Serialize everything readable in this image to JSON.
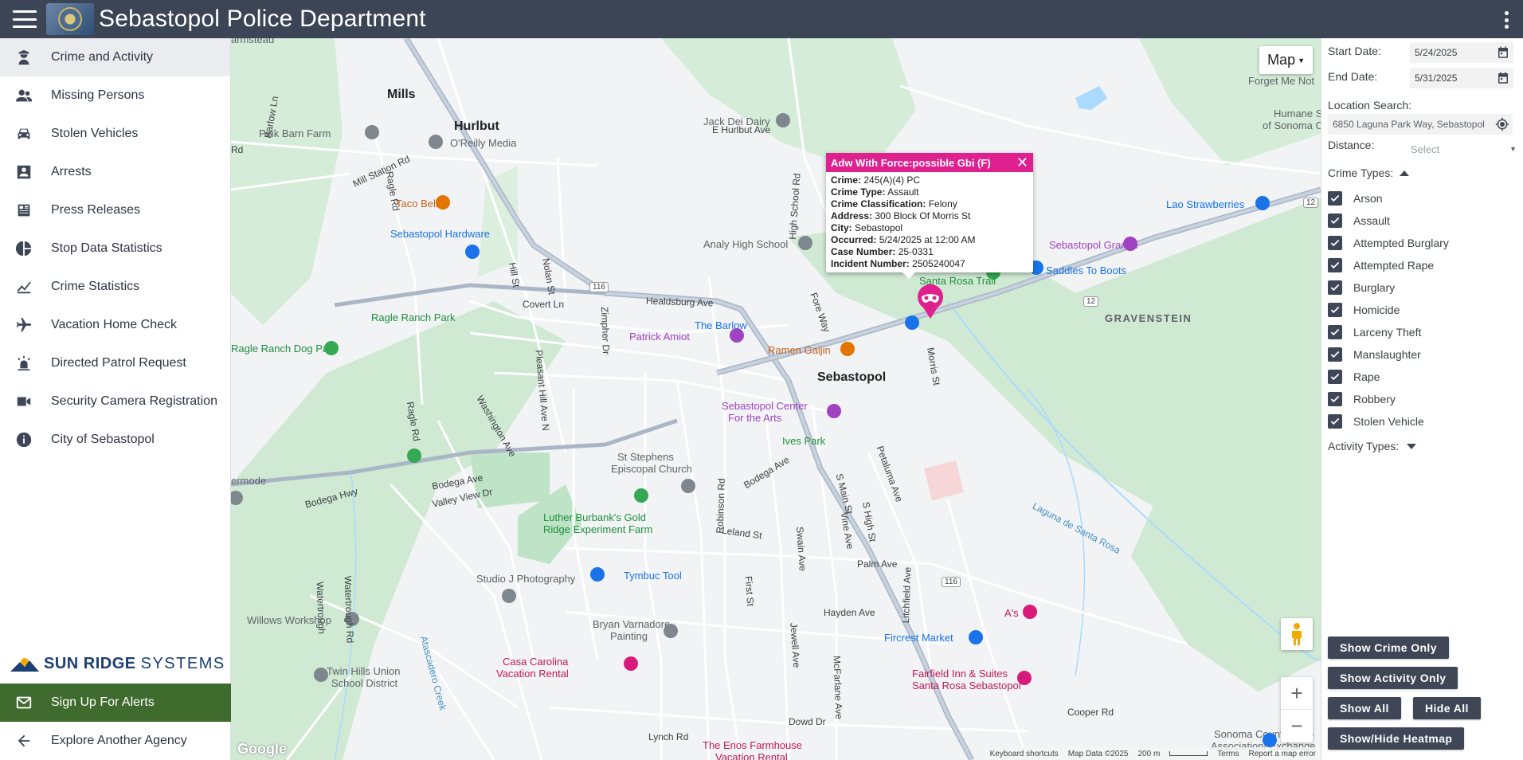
{
  "header": {
    "title": "Sebastopol Police Department"
  },
  "sidebar": {
    "items": [
      {
        "label": "Crime and Activity",
        "icon": "police-officer-icon"
      },
      {
        "label": "Missing Persons",
        "icon": "people-icon"
      },
      {
        "label": "Stolen Vehicles",
        "icon": "car-icon"
      },
      {
        "label": "Arrests",
        "icon": "id-card-icon"
      },
      {
        "label": "Press Releases",
        "icon": "newspaper-icon"
      },
      {
        "label": "Stop Data Statistics",
        "icon": "pie-chart-icon"
      },
      {
        "label": "Crime Statistics",
        "icon": "line-chart-icon"
      },
      {
        "label": "Vacation Home Check",
        "icon": "airplane-icon"
      },
      {
        "label": "Directed Patrol Request",
        "icon": "siren-icon"
      },
      {
        "label": "Security Camera Registration",
        "icon": "video-camera-icon"
      },
      {
        "label": "City of Sebastopol",
        "icon": "info-icon"
      }
    ],
    "brand": {
      "bold": "SUN RIDGE",
      "light": "SYSTEMS"
    },
    "alerts_label": "Sign Up For Alerts",
    "explore_label": "Explore Another Agency"
  },
  "map": {
    "type_label": "Map",
    "labels": {
      "mills": "Mills",
      "hurlbut": "Hurlbut",
      "sebastopol": "Sebastopol",
      "gravenstein": "GRAVENSTEIN",
      "pink_barn": "Pink Barn Farm",
      "oreilly": "O'Reilly Media",
      "taco_bell": "Taco Bell",
      "hardware": "Sebastopol Hardware",
      "analy": "Analy High School",
      "jack_dei": "Jack Dei Dairy",
      "ragle_ranch": "Ragle Ranch Park",
      "ragle_dog": "Ragle Ranch Dog Park",
      "patrick": "Patrick Amiot",
      "barlow": "The Barlow",
      "ramen": "Ramen Gaijin",
      "center1": "Sebastopol Center",
      "center2": "For the Arts",
      "ives": "Ives Park",
      "st_stephens1": "St Stephens",
      "st_stephens2": "Episcopal Church",
      "luther1": "Luther Burbank's Gold",
      "luther2": "Ridge Experiment Farm",
      "tymbuc": "Tymbuc Tool",
      "studio_j": "Studio J Photography",
      "willows": "Willows Workshop",
      "twin_hills1": "Twin Hills Union",
      "twin_hills2": "School District",
      "bryan1": "Bryan Varnadore",
      "bryan2": "Painting",
      "casa1": "Casa Carolina",
      "casa2": "Vacation Rental",
      "fircrest": "Fircrest Market",
      "fairfield1": "Fairfield Inn & Suites",
      "fairfield2": "Santa Rosa Sebastopol",
      "as": "A's",
      "enos1": "The Enos Farmhouse",
      "enos2": "Vacation Rental",
      "grange": "Sebastopol Grange",
      "saddles": "Saddles To Boots",
      "santa_rosa_trail": "Santa Rosa Trail",
      "lao": "Lao Strawberries",
      "forget": "Forget Me Not",
      "humane1": "Humane S",
      "humane2": "of Sonoma Co",
      "herb1": "Sonoma County Herb",
      "herb2": "Association/ Exchange",
      "farmstead": "armstead",
      "ermode": "ermode",
      "mill_station": "Mill Station Rd",
      "barlow_ln": "Barlow Ln",
      "ragle_rd": "Ragle Rd",
      "ragle_rd2": "Ragle Rd",
      "rd_left": "Rd",
      "e_hurlbut": "E Hurlbut Ave",
      "high_school": "High School Rd",
      "healdsburg": "Healdsburg Ave",
      "covert": "Covert Ln",
      "zimpher": "Zimpher Dr",
      "pleasant_hill": "Pleasant Hill Ave N",
      "washington": "Washington Ave",
      "bodega_ave": "Bodega Ave",
      "bodega_ave2": "Bodega Ave",
      "bodega_hwy": "Bodega Hwy",
      "valley_view": "Valley View Dr",
      "leland": "Leland St",
      "robinson": "Robinson Rd",
      "petaluma": "Petaluma Ave",
      "main_st": "S Main St",
      "high_st": "S High St",
      "palm": "Palm Ave",
      "litchfield": "Litchfield Ave",
      "hayden": "Hayden Ave",
      "mcfarlane": "McFarlane Ave",
      "dowd": "Dowd Dr",
      "lynch": "Lynch Rd",
      "cooper": "Cooper Rd",
      "laguna": "Laguna de Santa Rosa",
      "waterthrough": "Watertrough Rd",
      "atascadero": "Atascadero Creek",
      "fore": "Fore Way",
      "morris": "Morris St",
      "hill": "Hill St",
      "nolan": "Nolan St",
      "jewell": "Jewell Ave",
      "swain": "Swain Ave",
      "first": "First St",
      "vine": "Vine Ave",
      "rt116": "116",
      "rt116b": "116",
      "rt12": "12",
      "rt12b": "12",
      "waterthrough2": "Watertrough"
    },
    "popup": {
      "title": "Adw With Force:possible Gbi (F)",
      "crime_label": "Crime:",
      "crime": "245(A)(4) PC",
      "type_label": "Crime Type:",
      "type": "Assault",
      "class_label": "Crime Classification:",
      "class": "Felony",
      "address_label": "Address:",
      "address": "300 Block Of Morris St",
      "city_label": "City:",
      "city": "Sebastopol",
      "occurred_label": "Occurred:",
      "occurred": "5/24/2025 at 12:00 AM",
      "case_label": "Case Number:",
      "case": "25-0331",
      "incident_label": "Incident Number:",
      "incident": "2505240047"
    },
    "attribution": {
      "shortcuts": "Keyboard shortcuts",
      "data": "Map Data ©2025",
      "scale": "200 m",
      "terms": "Terms",
      "report": "Report a map error"
    },
    "google": "Google"
  },
  "filters": {
    "start_label": "Start Date:",
    "start_value": "5/24/2025",
    "end_label": "End Date:",
    "end_value": "5/31/2025",
    "location_label": "Location Search:",
    "location_value": "6850 Laguna Park Way, Sebastopol",
    "distance_label": "Distance:",
    "distance_placeholder": "Select",
    "crime_types_label": "Crime Types:",
    "crime_types": [
      "Arson",
      "Assault",
      "Attempted Burglary",
      "Attempted Rape",
      "Burglary",
      "Homicide",
      "Larceny Theft",
      "Manslaughter",
      "Rape",
      "Robbery",
      "Stolen Vehicle"
    ],
    "activity_types_label": "Activity Types:",
    "buttons": {
      "crime_only": "Show Crime Only",
      "activity_only": "Show Activity Only",
      "show_all": "Show All",
      "hide_all": "Hide All",
      "heatmap": "Show/Hide Heatmap"
    }
  },
  "colors": {
    "header_bg": "#3b4556",
    "alert_green": "#3f6b2e",
    "popup_magenta": "#e0208f",
    "button_dark": "#3f4756"
  }
}
